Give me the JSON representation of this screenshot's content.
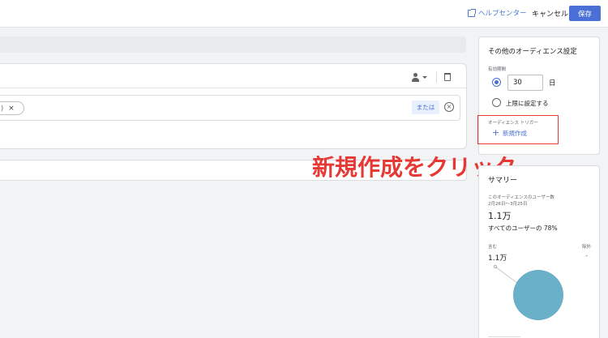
{
  "header": {
    "help_label": "ヘルプセンター",
    "cancel_label": "キャンセル",
    "save_label": "保存"
  },
  "audience_condition": {
    "chip_text": ")",
    "chip_close": "×",
    "or_label": "または",
    "remove_symbol": "×"
  },
  "other_settings": {
    "title": "その他のオーディエンス設定",
    "duration_label": "有効期間",
    "duration_value": "30",
    "duration_unit": "日",
    "max_option_label": "上限に設定する",
    "trigger_label": "オーディエンス トリガー",
    "new_label": "新規作成"
  },
  "annotation": {
    "text": "新規作成をクリック",
    "color": "#e53935"
  },
  "summary": {
    "title": "サマリー",
    "users_label": "このオーディエンスのユーザー数",
    "date_range": "2月26日～3月25日",
    "users_value": "1.1万",
    "users_ratio": "すべてのユーザーの 78%",
    "included_label": "含む",
    "excluded_label": "除外",
    "included_value": "1.1万",
    "excluded_value": "-",
    "pie_color": "#6ab0c8",
    "included_share": 1.0
  },
  "colors": {
    "accent": "#4a6fd6",
    "link": "#4a7bd0",
    "highlight": "#e53935"
  }
}
